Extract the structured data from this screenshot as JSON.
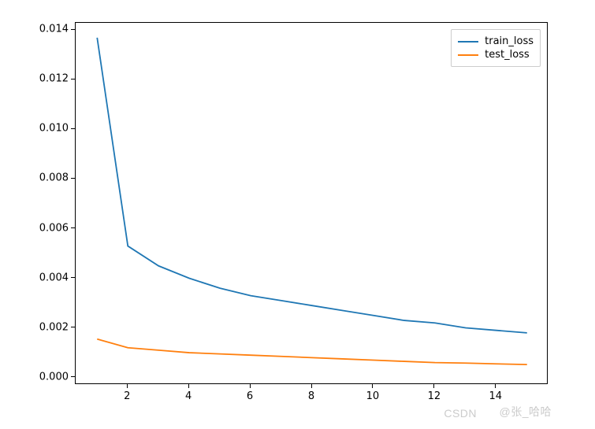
{
  "chart_data": {
    "type": "line",
    "x": [
      1,
      2,
      3,
      4,
      5,
      6,
      7,
      8,
      9,
      10,
      11,
      12,
      13,
      14,
      15
    ],
    "series": [
      {
        "name": "train_loss",
        "color": "#1f77b4",
        "values": [
          0.0137,
          0.0053,
          0.0045,
          0.004,
          0.0036,
          0.0033,
          0.0031,
          0.0029,
          0.0027,
          0.0025,
          0.0023,
          0.0022,
          0.002,
          0.0019,
          0.0018
        ]
      },
      {
        "name": "test_loss",
        "color": "#ff7f0e",
        "values": [
          0.00155,
          0.0012,
          0.0011,
          0.001,
          0.00095,
          0.0009,
          0.00085,
          0.0008,
          0.00075,
          0.0007,
          0.00065,
          0.0006,
          0.00058,
          0.00055,
          0.00052
        ]
      }
    ],
    "xlim": [
      0.3,
      15.7
    ],
    "ylim": [
      -0.0003,
      0.0143
    ],
    "xticks": [
      2,
      4,
      6,
      8,
      10,
      12,
      14
    ],
    "yticks": [
      0.0,
      0.002,
      0.004,
      0.006,
      0.008,
      0.01,
      0.012,
      0.014
    ],
    "ytick_labels": [
      "0.000",
      "0.002",
      "0.004",
      "0.006",
      "0.008",
      "0.010",
      "0.012",
      "0.014"
    ],
    "title": "",
    "xlabel": "",
    "ylabel": "",
    "legend_position": "upper-right"
  },
  "legend": {
    "items": [
      {
        "label": "train_loss",
        "color": "#1f77b4"
      },
      {
        "label": "test_loss",
        "color": "#ff7f0e"
      }
    ]
  },
  "watermark": {
    "left": "CSDN",
    "right": "@张_哈哈"
  }
}
